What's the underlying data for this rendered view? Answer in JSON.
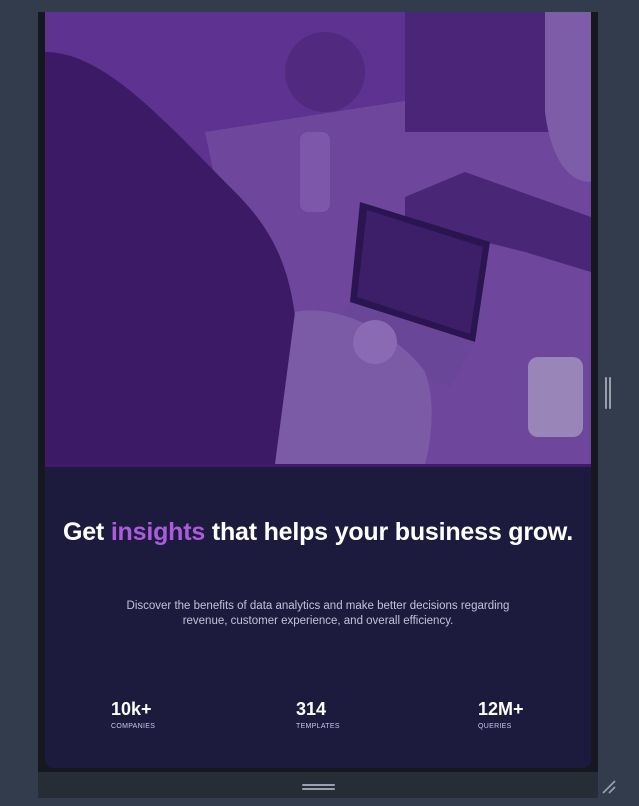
{
  "heading": {
    "prefix": "Get",
    "accent": "insights",
    "suffix": "that helps your business grow."
  },
  "description": "Discover the benefits of data analytics and make better decisions regarding revenue, customer experience, and overall efficiency.",
  "stats": [
    {
      "value": "10k+",
      "label": "COMPANIES"
    },
    {
      "value": "314",
      "label": "TEMPLATES"
    },
    {
      "value": "12M+",
      "label": "QUERIES"
    }
  ],
  "colors": {
    "background": "#323c4c",
    "card": "#1c1b3e",
    "hero_overlay": "#5a2f8c",
    "accent": "#aa5cdb"
  },
  "icons": {
    "drag_handle": "horizontal-grip-icon",
    "side_handle": "vertical-grip-icon",
    "resize": "resize-corner-icon"
  }
}
